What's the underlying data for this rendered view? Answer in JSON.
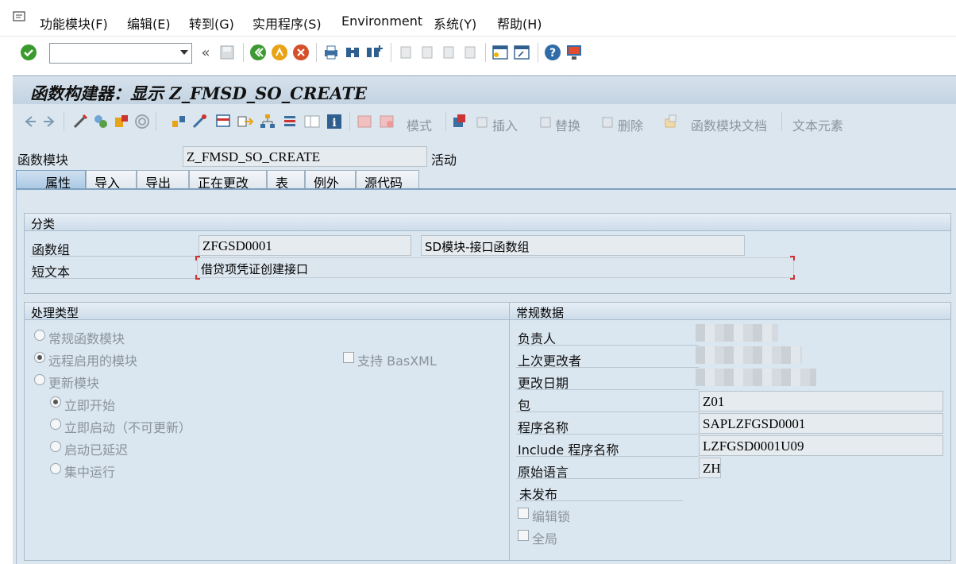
{
  "menu": {
    "icon": "menu-icon",
    "items": [
      "功能模块(F)",
      "编辑(E)",
      "转到(G)",
      "实用程序(S)",
      "Environment",
      "系统(Y)",
      "帮助(H)"
    ]
  },
  "toolbar": {
    "command_value": "",
    "back_chevrons": "«"
  },
  "window": {
    "title": "函数构建器：显示 Z_FMSD_SO_CREATE"
  },
  "app_toolbar": {
    "labels": {
      "mode": "模式",
      "insert": "插入",
      "replace": "替换",
      "delete": "删除",
      "fm_doc": "函数模块文档",
      "text_elements": "文本元素"
    }
  },
  "header": {
    "fm_label": "函数模块",
    "fm_value": "Z_FMSD_SO_CREATE",
    "status": "活动"
  },
  "tabs": [
    "属性",
    "导入",
    "导出",
    "正在更改",
    "表",
    "例外",
    "源代码"
  ],
  "classification": {
    "title": "分类",
    "group_label": "函数组",
    "group_value": "ZFGSD0001",
    "group_desc": "SD模块-接口函数组",
    "short_text_label": "短文本",
    "short_text_value": "借贷项凭证创建接口"
  },
  "processing": {
    "title": "处理类型",
    "normal": "常规函数模块",
    "remote": "远程启用的模块",
    "basxml": "支持 BasXML",
    "update": "更新模块",
    "immediate": "立即开始",
    "immediate_no_update": "立即启动（不可更新）",
    "delayed": "启动已延迟",
    "collective": "集中运行"
  },
  "general": {
    "title": "常规数据",
    "responsible": "负责人",
    "last_changed_by": "上次更改者",
    "changed_on": "更改日期",
    "package_label": "包",
    "package_value": "Z01",
    "program_label": "程序名称",
    "program_value": "SAPLZFGSD0001",
    "include_label": "Include 程序名称",
    "include_value": "LZFGSD0001U09",
    "lang_label": "原始语言",
    "lang_value": "ZH",
    "not_released": "未发布",
    "edit_lock": "编辑锁",
    "global": "全局"
  }
}
